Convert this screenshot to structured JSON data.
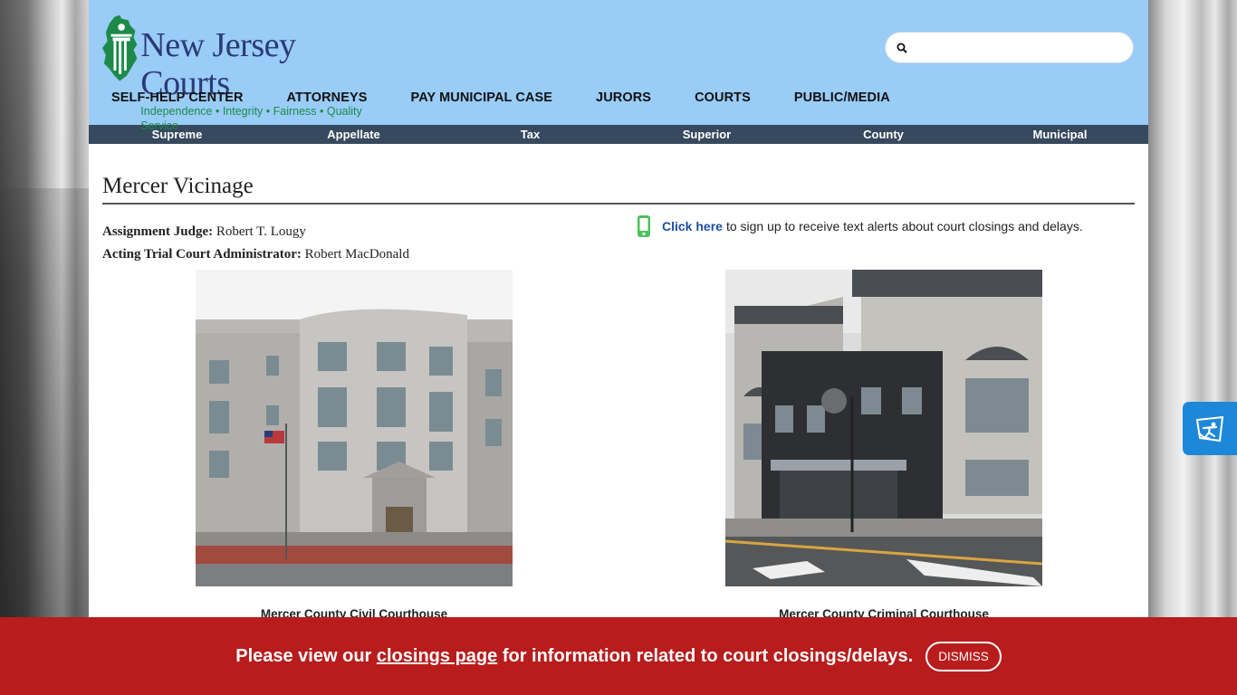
{
  "header": {
    "logo_title": "New Jersey Courts",
    "logo_tagline": "Independence • Integrity • Fairness • Quality Service",
    "search_placeholder": ""
  },
  "main_nav": [
    {
      "label": "SELF-HELP CENTER"
    },
    {
      "label": "ATTORNEYS"
    },
    {
      "label": "PAY MUNICIPAL CASE"
    },
    {
      "label": "JURORS"
    },
    {
      "label": "COURTS"
    },
    {
      "label": "PUBLIC/MEDIA"
    }
  ],
  "sub_nav": [
    {
      "label": "Supreme"
    },
    {
      "label": "Appellate"
    },
    {
      "label": "Tax"
    },
    {
      "label": "Superior"
    },
    {
      "label": "County"
    },
    {
      "label": "Municipal"
    }
  ],
  "page": {
    "title": "Mercer Vicinage",
    "assignment_judge_label": "Assignment Judge:",
    "assignment_judge_name": "Robert T. Lougy",
    "tca_label": "Acting Trial Court Administrator:",
    "tca_name": "Robert MacDonald",
    "alert_link": "Click here",
    "alert_text": "to sign up to receive text alerts about court closings and delays."
  },
  "photos": [
    {
      "caption": "Mercer County Civil Courthouse"
    },
    {
      "caption": "Mercer County Criminal Courthouse"
    }
  ],
  "banner": {
    "text_before": "Please view our",
    "link": "closings page",
    "text_after": "for information related to court closings/delays.",
    "dismiss": "DISMISS"
  },
  "colors": {
    "header_bg": "#99ccf7",
    "subnav_bg": "#36495e",
    "banner_bg": "#b81c1c",
    "link": "#1d4fa0",
    "accessibility_btn": "#1e88d8"
  },
  "icons": [
    "search-icon",
    "mobile-phone-icon",
    "accessibility-icon"
  ]
}
